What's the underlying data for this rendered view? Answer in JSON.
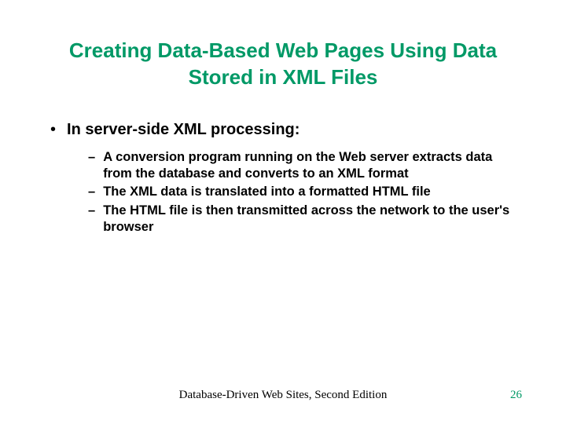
{
  "slide": {
    "title": "Creating Data-Based Web Pages Using Data Stored in XML Files",
    "bullet1": {
      "text": "In server-side XML processing:"
    },
    "sub_bullets": [
      "A conversion program running on the Web server extracts data from the database and converts to an XML format",
      "The XML data is translated into a formatted HTML file",
      "The HTML file is then transmitted across the network to the user's browser"
    ],
    "footer": {
      "text": "Database-Driven Web Sites, Second Edition",
      "page": "26"
    }
  }
}
